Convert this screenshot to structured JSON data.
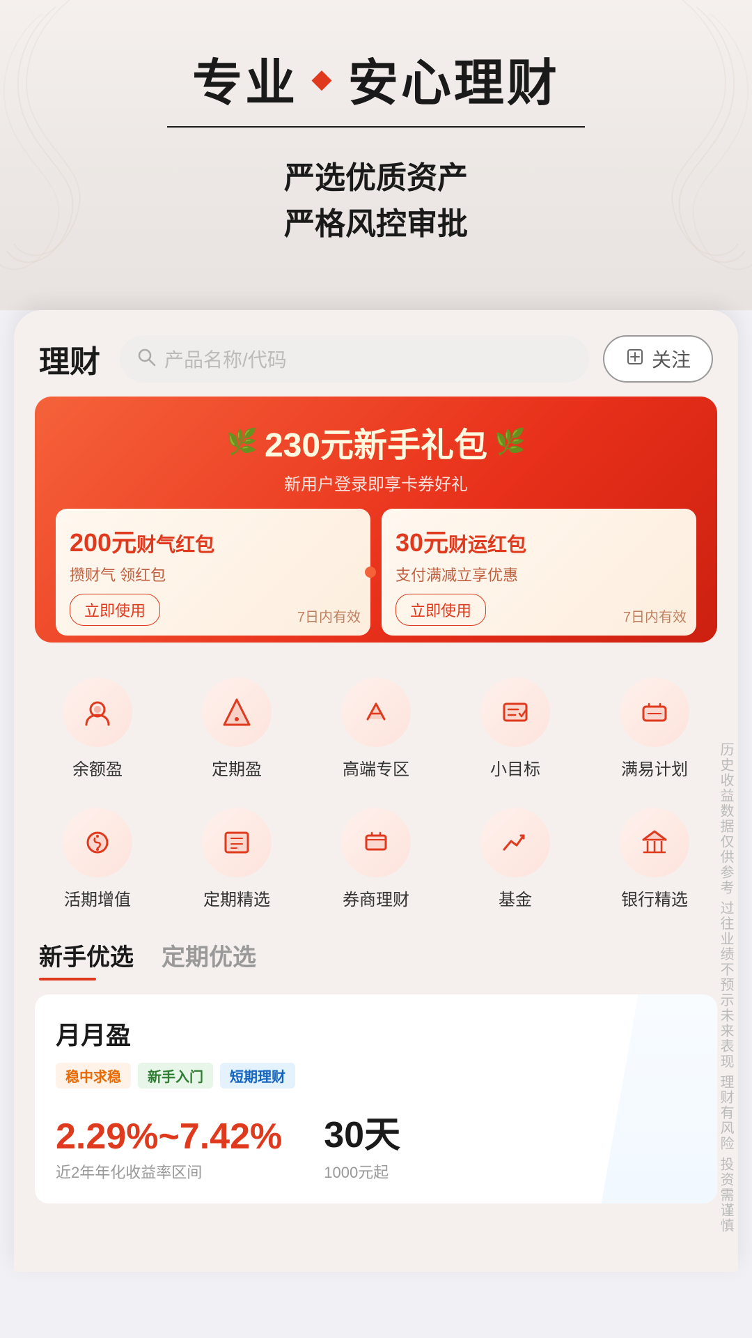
{
  "hero": {
    "title_left": "专业",
    "diamond": "◆",
    "title_right": "安心理财",
    "subtitle_line1": "严选优质资产",
    "subtitle_line2": "严格风控审批"
  },
  "header": {
    "title": "理财",
    "search_placeholder": "产品名称/代码",
    "follow_label": "关注"
  },
  "banner": {
    "main_text": "230元新手礼包",
    "sub_text": "新用户登录即享卡券好礼",
    "card1": {
      "amount": "200元",
      "name": "财气红包",
      "desc": "攒财气 领红包",
      "btn": "立即使用",
      "validity": "7日内有效"
    },
    "card2": {
      "amount": "30元",
      "name": "财运红包",
      "desc": "支付满减立享优惠",
      "btn": "立即使用",
      "validity": "7日内有效"
    }
  },
  "grid_row1": [
    {
      "id": "yuebao",
      "label": "余额盈"
    },
    {
      "id": "dingqibao",
      "label": "定期盈"
    },
    {
      "id": "gaoduan",
      "label": "高端专区"
    },
    {
      "id": "xiaomubiao",
      "label": "小目标"
    },
    {
      "id": "manyiji",
      "label": "满易计划"
    }
  ],
  "grid_row2": [
    {
      "id": "huoqizengzhi",
      "label": "活期增值"
    },
    {
      "id": "dingqijingxuan",
      "label": "定期精选"
    },
    {
      "id": "quanshang",
      "label": "券商理财"
    },
    {
      "id": "jijin",
      "label": "基金"
    },
    {
      "id": "yinhang",
      "label": "银行精选"
    }
  ],
  "tabs": [
    {
      "label": "新手优选",
      "active": true
    },
    {
      "label": "定期优选",
      "active": false
    }
  ],
  "product": {
    "name": "月月盈",
    "tags": [
      "稳中求稳",
      "新手入门",
      "短期理财"
    ],
    "yield_rate": "2.29%~7.42%",
    "yield_desc": "近2年年化收益率区间",
    "period": "30天",
    "period_desc": "1000元起"
  },
  "sidebar_text": "历史收益数据仅供参考 过往业绩不预示未来表现 理财有风险 投资需谨慎"
}
